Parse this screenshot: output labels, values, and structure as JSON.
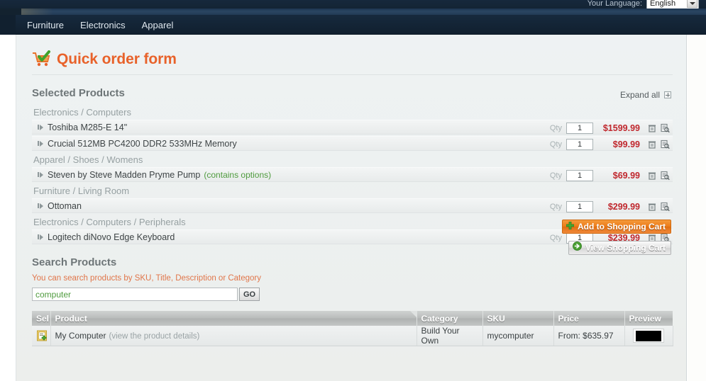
{
  "topbar": {
    "language_label": "Your Language:",
    "language_value": "English"
  },
  "nav": {
    "items": [
      {
        "label": "Furniture"
      },
      {
        "label": "Electronics"
      },
      {
        "label": "Apparel"
      }
    ]
  },
  "page": {
    "title": "Quick order form",
    "title_color": "#e8622a"
  },
  "selected_products": {
    "heading": "Selected Products",
    "expand_all_label": "Expand all",
    "qty_label": "Qty",
    "groups": [
      {
        "category": "Electronics / Computers",
        "items": [
          {
            "name": "Toshiba M285-E 14\"",
            "options": "",
            "qty": "1",
            "price": "$1599.99"
          },
          {
            "name": "Crucial 512MB PC4200 DDR2 533MHz Memory",
            "options": "",
            "qty": "1",
            "price": "$99.99"
          }
        ]
      },
      {
        "category": "Apparel / Shoes / Womens",
        "items": [
          {
            "name": "Steven by Steve Madden Pryme Pump",
            "options": "(contains options)",
            "qty": "1",
            "price": "$69.99"
          }
        ]
      },
      {
        "category": "Furniture / Living Room",
        "items": [
          {
            "name": "Ottoman",
            "options": "",
            "qty": "1",
            "price": "$299.99"
          }
        ]
      },
      {
        "category": "Electronics / Computers / Peripherals",
        "items": [
          {
            "name": "Logitech diNovo Edge Keyboard",
            "options": "",
            "qty": "1",
            "price": "$239.99"
          }
        ]
      }
    ]
  },
  "actions": {
    "add_to_cart_label": "Add to Shopping Cart",
    "view_cart_label": "View Shopping Cart"
  },
  "search": {
    "heading": "Search Products",
    "hint": "You can search products by SKU, Title, Description or Category",
    "value": "computer",
    "placeholder": "",
    "go_label": "GO"
  },
  "results": {
    "columns": [
      "Sel",
      "Product",
      "Category",
      "SKU",
      "Price",
      "Preview"
    ],
    "rows": [
      {
        "product": "My Computer",
        "product_detail_link": "(view the product details)",
        "category": "Build Your Own",
        "sku": "mycomputer",
        "price": "From: $635.97"
      }
    ]
  },
  "colors": {
    "accent_orange": "#e8622a",
    "price_red": "#c0272d",
    "option_green": "#4f9b3e",
    "nav_dark": "#11202f"
  }
}
